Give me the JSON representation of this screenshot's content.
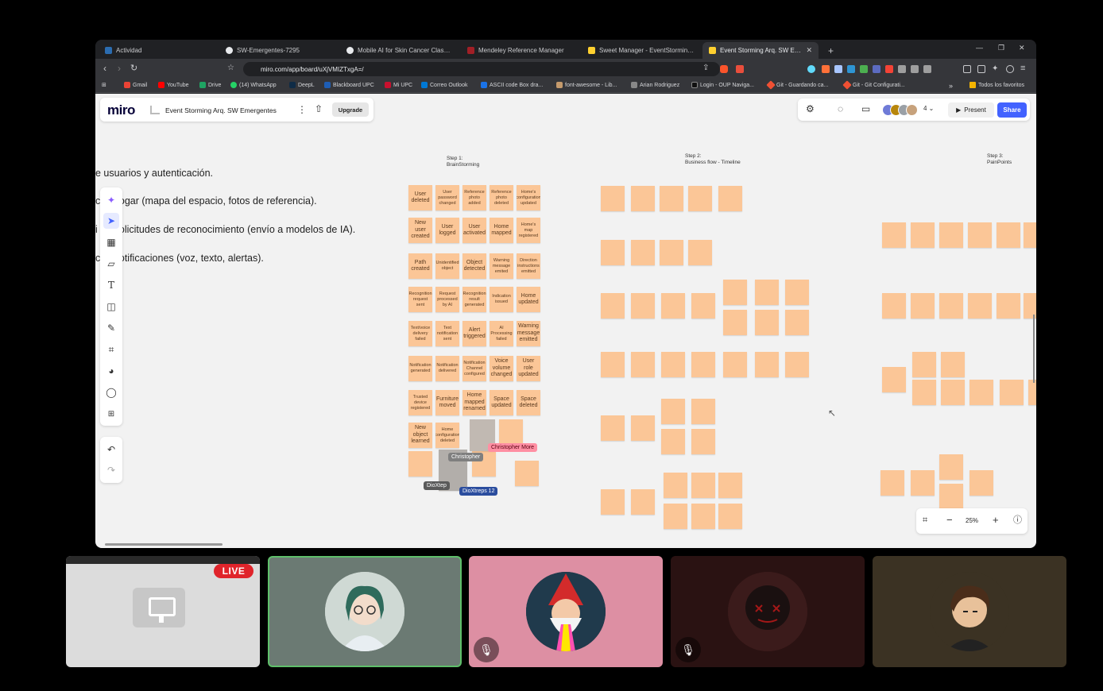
{
  "browser": {
    "tabs": [
      {
        "label": "Actividad",
        "color": "#2b6cb0"
      },
      {
        "label": "SW-Emergentes-7295",
        "color": "#e8eaed"
      },
      {
        "label": "Mobile AI for Skin Cancer Classificati...",
        "color": "#e8eaed"
      },
      {
        "label": "Mendeley Reference Manager",
        "color": "#a11f26"
      },
      {
        "label": "Sweet Manager - EventStorming - Mi...",
        "color": "#ffd02f"
      },
      {
        "label": "Event Storming Arq. SW Emergen...",
        "color": "#ffd02f"
      }
    ],
    "url": "miro.com/app/board/uXjVMIZTxgA=/",
    "bookmarks": [
      {
        "label": "Gmail",
        "color": "#ea4335"
      },
      {
        "label": "YouTube",
        "color": "#ff0000"
      },
      {
        "label": "Drive",
        "color": "#1fa463"
      },
      {
        "label": "(14) WhatsApp",
        "color": "#25d366"
      },
      {
        "label": "DeepL",
        "color": "#0f2b46"
      },
      {
        "label": "Blackboard UPC",
        "color": "#1e5eb5"
      },
      {
        "label": "Mi UPC",
        "color": "#c8102e"
      },
      {
        "label": "Correo Outlook",
        "color": "#0078d4"
      },
      {
        "label": "ASCII code Box dra...",
        "color": "#1a73e8"
      },
      {
        "label": "font-awesome - Lib...",
        "color": "#c49a6c"
      },
      {
        "label": "Arian Rodriguez",
        "color": "#888888"
      },
      {
        "label": "Login - OUP Naviga...",
        "color": "#111111"
      },
      {
        "label": "Git - Guardando ca...",
        "color": "#f05033"
      },
      {
        "label": "Git - Git Configurati...",
        "color": "#f05033"
      }
    ],
    "all_bookmarks": "Todos los favoritos"
  },
  "miro": {
    "logo": "miro",
    "board_name": "Event Storming Arq. SW Emergentes",
    "upgrade": "Upgrade",
    "collab_count": "4",
    "present": "Present",
    "share": "Share",
    "zoom": "25%"
  },
  "board": {
    "bullets": [
      "e usuarios y autenticación.",
      "c  el hogar (mapa del espacio, fotos de referencia).",
      "i  de solicitudes de reconocimiento (envío a modelos de IA).",
      "ci  e notificaciones (voz, texto, alertas)."
    ],
    "steps": [
      {
        "line1": "Step 1:",
        "line2": "BrainStorming"
      },
      {
        "line1": "Step 2:",
        "line2": "Business flow - Timeline"
      },
      {
        "line1": "Step 3:",
        "line2": "PainPoints"
      }
    ],
    "notes": [
      "User deleted",
      "User password changed",
      "Reference photo added",
      "Reference photo deleted",
      "Home's configuration updated",
      "New user created",
      "User logged",
      "User activated",
      "Home mapped",
      "Home's map registered",
      "Path created",
      "Unidentified object",
      "Object detected",
      "Warning message emited",
      "Direction instructions emitted",
      "Recognition request sent",
      "Request processed by AI",
      "Recognition result generated",
      "Indication issued",
      "Home updated",
      "Text/voice delivery failed",
      "Text notification sent",
      "Alert triggered",
      "AI Processing failed",
      "Warning message emitted",
      "Notification generated",
      "Notification delivered",
      "Notification Channel configured",
      "Voice volume changed",
      "User role updated",
      "Trusted device registered",
      "Furniture moved",
      "Home mapped renamed",
      "Space updated",
      "Space deleted",
      "New object learned",
      "Home configuration deleted"
    ],
    "cursors": [
      "Christopher More",
      "Christopher",
      "DioXtep",
      "DioXtreps 12"
    ]
  },
  "meeting": {
    "live": "LIVE"
  }
}
